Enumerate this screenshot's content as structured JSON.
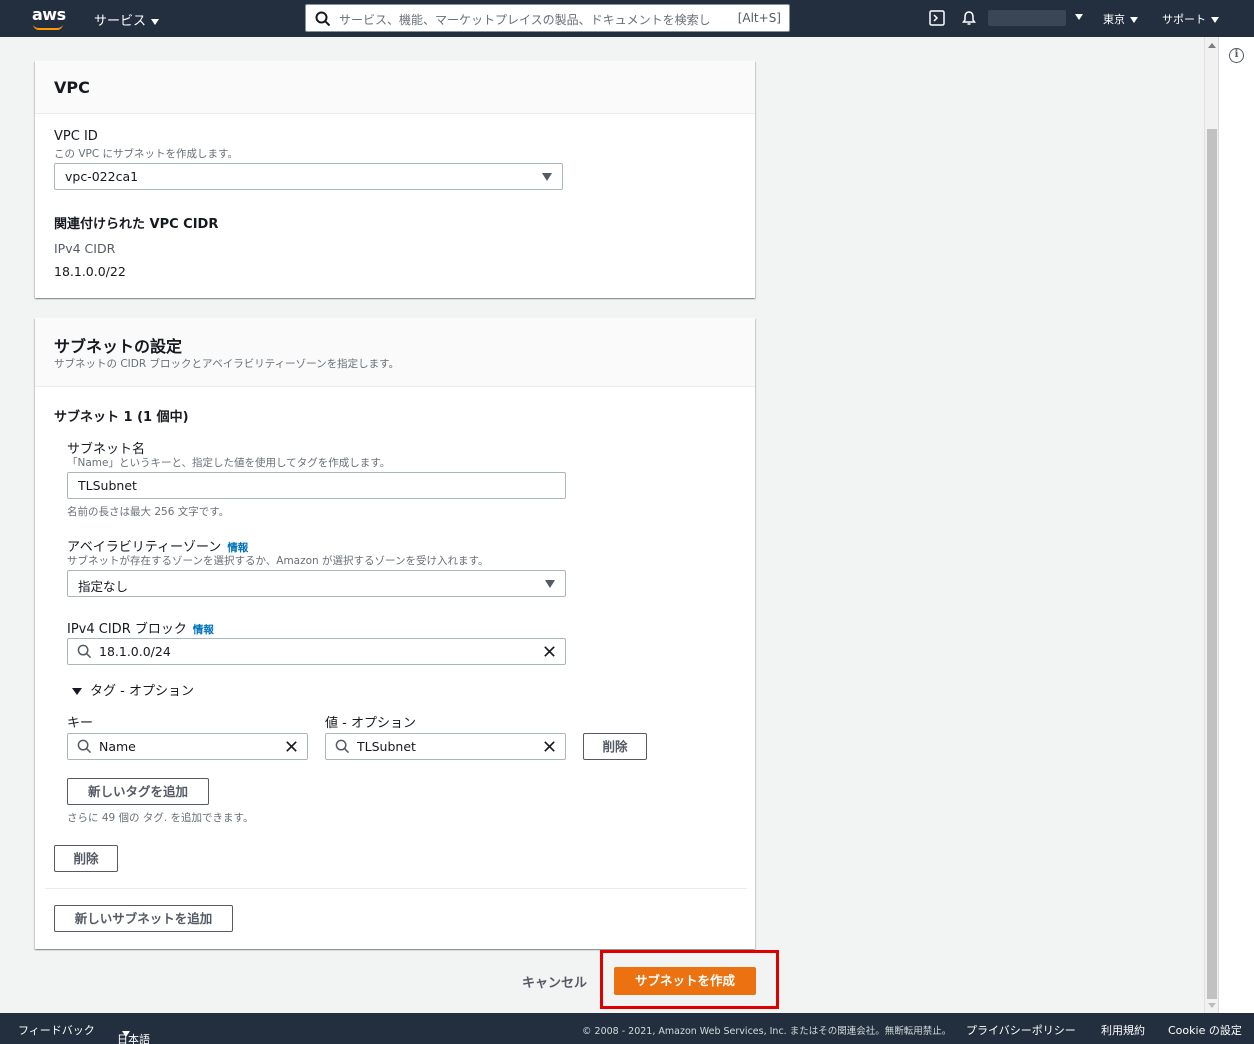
{
  "header": {
    "logo_text": "aws",
    "services_label": "サービス",
    "search_placeholder": "サービス、機能、マーケットプレイスの製品、ドキュメントを検索し",
    "search_shortcut": "[Alt+S]",
    "region_label": "東京",
    "support_label": "サポート",
    "icons": [
      "cloudshell-icon",
      "bell-icon",
      "search-icon"
    ],
    "accent_color": "#ff9900"
  },
  "vpc_card": {
    "title": "VPC",
    "vpc_id_label": "VPC ID",
    "vpc_id_desc": "この VPC にサブネットを作成します。",
    "vpc_id_value": "vpc-022ca1",
    "cidr_heading": "関連付けられた VPC CIDR",
    "ipv4_label": "IPv4 CIDR",
    "ipv4_value": "18.1.0.0/22"
  },
  "subnet_card": {
    "title": "サブネットの設定",
    "desc": "サブネットの CIDR ブロックとアベイラビリティーゾーンを指定します。",
    "subnet_heading": "サブネット 1 (1 個中)",
    "name_label": "サブネット名",
    "name_desc": "「Name」というキーと、指定した値を使用してタグを作成します。",
    "name_value": "TLSubnet",
    "name_hint": "名前の長さは最大 256 文字です。",
    "az_label": "アベイラビリティーゾーン",
    "az_info": "情報",
    "az_desc": "サブネットが存在するゾーンを選択するか、Amazon が選択するゾーンを受け入れます。",
    "az_value": "指定なし",
    "cidr_label": "IPv4 CIDR ブロック",
    "cidr_info": "情報",
    "cidr_value": "18.1.0.0/24",
    "tags_toggle": "タグ - オプション",
    "key_label": "キー",
    "value_label": "値 - オプション",
    "tag_key": "Name",
    "tag_value": "TLSubnet",
    "remove_tag_btn": "削除",
    "add_tag_btn": "新しいタグを追加",
    "tags_remaining": "さらに 49 個の タグ. を追加できます。",
    "remove_subnet_btn": "削除",
    "add_subnet_btn": "新しいサブネットを追加"
  },
  "actions": {
    "cancel": "キャンセル",
    "create": "サブネットを作成",
    "primary_color": "#ec7211",
    "highlight_color": "#e00000"
  },
  "footer": {
    "feedback": "フィードバック",
    "language": "日本語",
    "copyright": "© 2008 - 2021, Amazon Web Services, Inc. またはその関連会社。無断転用禁止。",
    "privacy": "プライバシーポリシー",
    "terms": "利用規約",
    "cookie": "Cookie の設定"
  },
  "right_rail": {
    "info_symbol": "i"
  }
}
